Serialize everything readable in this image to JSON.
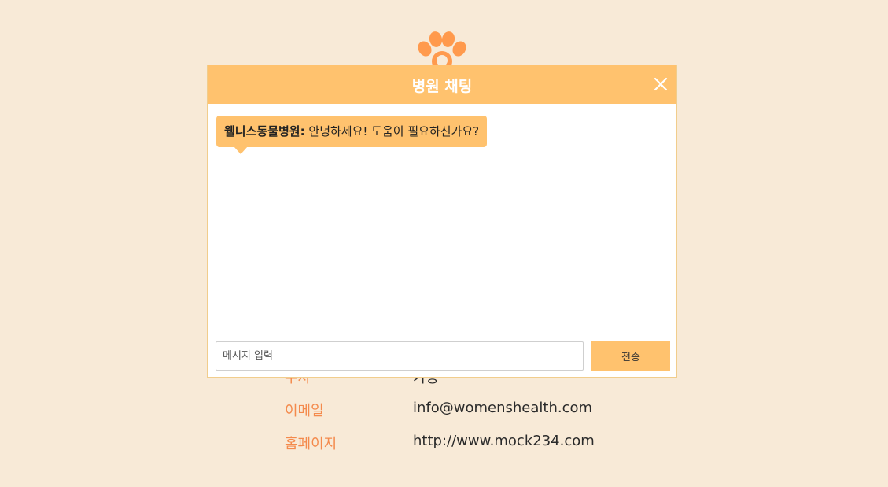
{
  "page": {
    "logo_icon": "paw-icon",
    "accent_color": "#f48a4c"
  },
  "info": {
    "rows": [
      {
        "label": "주차",
        "value": "가능"
      },
      {
        "label": "이메일",
        "value": "info@womenshealth.com"
      },
      {
        "label": "홈페이지",
        "value": "http://www.mock234.com"
      }
    ]
  },
  "chat": {
    "title": "병원 채팅",
    "header_color": "#ffc26e",
    "close_icon": "close-icon",
    "messages": [
      {
        "sender": "웰니스동물병원:",
        "text": "안녕하세요! 도움이 필요하신가요?"
      }
    ],
    "input": {
      "value": "",
      "placeholder": "메시지 입력"
    },
    "send_label": "전송"
  }
}
